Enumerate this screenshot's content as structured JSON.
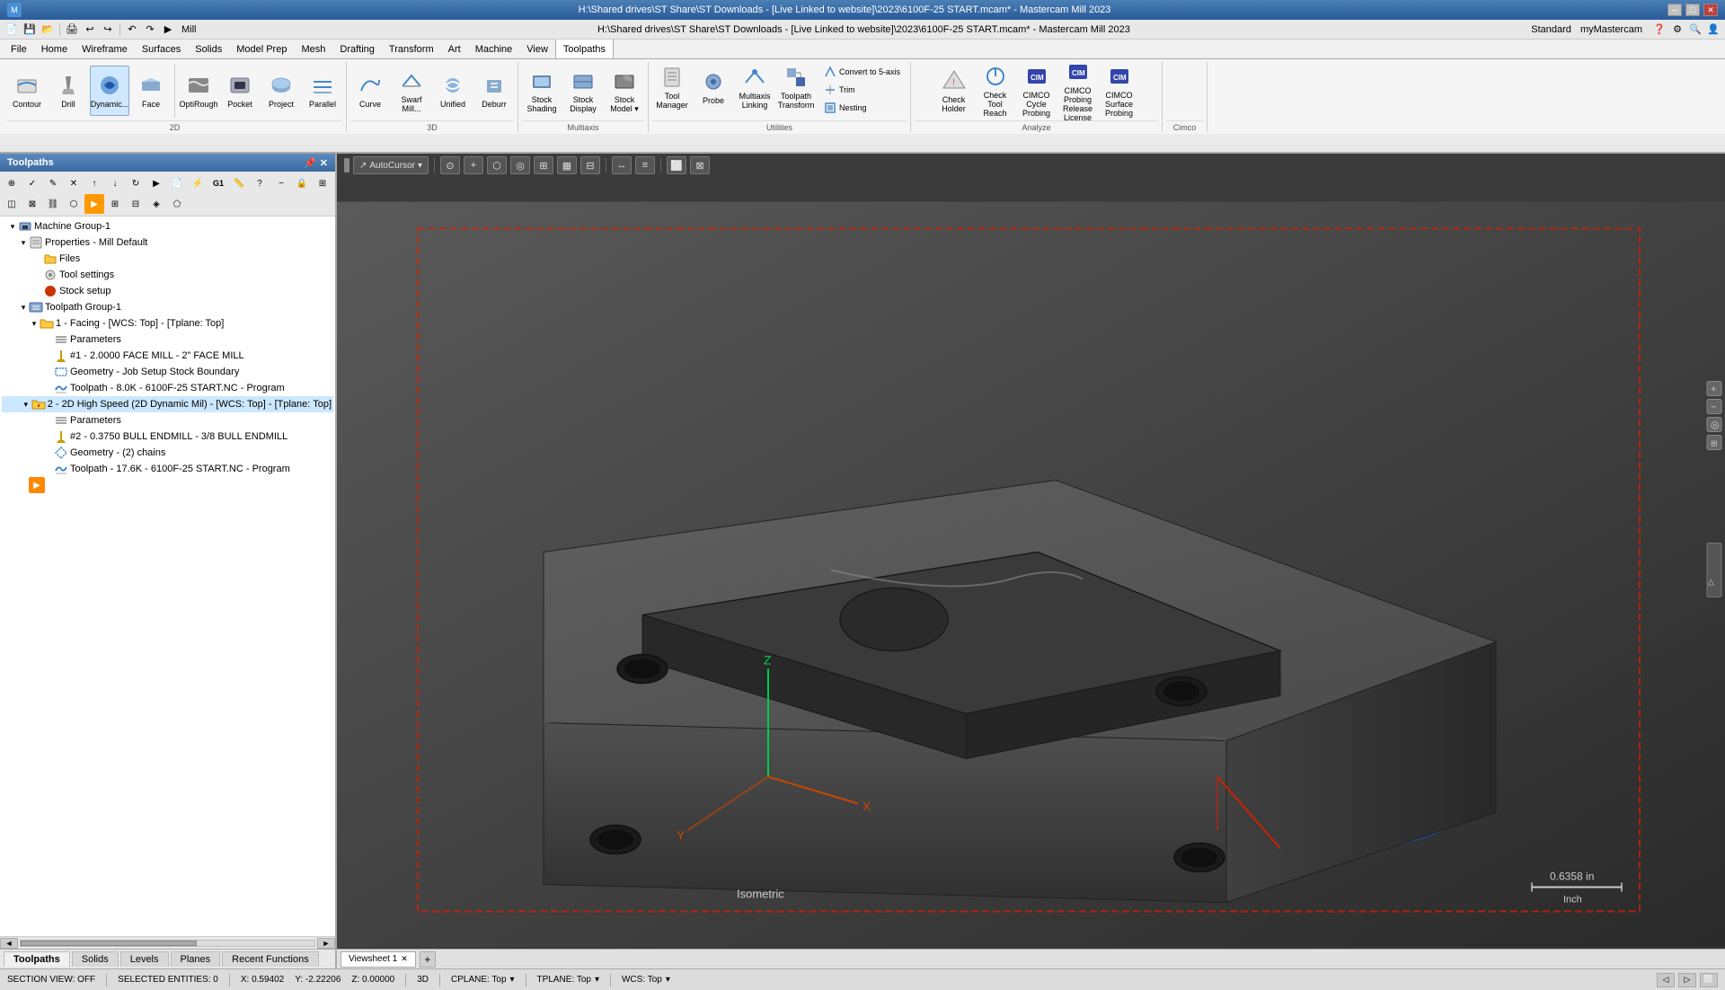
{
  "app": {
    "title": "H:\\Shared drives\\ST Share\\ST Downloads - [Live Linked to website]\\2023\\6100F-25 START.mcam* - Mastercam Mill 2023",
    "window_controls": [
      "minimize",
      "maximize",
      "close"
    ]
  },
  "menubar": {
    "items": [
      "File",
      "Home",
      "Wireframe",
      "Surfaces",
      "Solids",
      "Model Prep",
      "Mesh",
      "Drafting",
      "Transform",
      "Art",
      "Machine",
      "View",
      "Toolpaths"
    ]
  },
  "ribbon": {
    "active_tab": "Toolpaths",
    "tabs": [
      "File",
      "Home",
      "Wireframe",
      "Surfaces",
      "Solids",
      "Model Prep",
      "Mesh",
      "Drafting",
      "Transform",
      "Art",
      "Machine",
      "View",
      "Toolpaths"
    ],
    "groups": {
      "2d": {
        "label": "2D",
        "buttons": [
          "Contour",
          "Drill",
          "Dynamic...",
          "Face",
          "OptiRough",
          "Pocket",
          "Project",
          "Parallel"
        ]
      },
      "3d": {
        "label": "3D",
        "buttons": [
          "Curve",
          "Swarf Mill...",
          "Unified",
          "Deburr"
        ]
      },
      "multiaxis": {
        "label": "Multiaxis",
        "buttons": [
          "Stock Shading",
          "Stock Display",
          "Stock Model"
        ]
      },
      "utilities": {
        "label": "Utilities",
        "buttons": [
          "Tool Manager",
          "Probe",
          "Multiaxis Linking",
          "Toolpath Transform",
          "Convert to 5-axis",
          "Trim",
          "Nesting"
        ]
      },
      "analyze": {
        "label": "Analyze",
        "buttons": [
          "Check Holder",
          "Check Tool Reach",
          "CIMCO Cycle Probing",
          "CIMCO Probing Release License",
          "CIMCO Surface Probing"
        ]
      },
      "cimco": {
        "label": "Cimco"
      }
    }
  },
  "left_panel": {
    "title": "Toolpaths",
    "tree": [
      {
        "id": "machine-group-1",
        "label": "Machine Group-1",
        "level": 0,
        "icon": "machine",
        "expanded": true
      },
      {
        "id": "properties",
        "label": "Properties - Mill Default",
        "level": 1,
        "icon": "properties",
        "expanded": true
      },
      {
        "id": "files",
        "label": "Files",
        "level": 2,
        "icon": "folder"
      },
      {
        "id": "tool-settings",
        "label": "Tool settings",
        "level": 2,
        "icon": "wrench"
      },
      {
        "id": "stock-setup",
        "label": "Stock setup",
        "level": 2,
        "icon": "stock-red"
      },
      {
        "id": "toolpath-group-1",
        "label": "Toolpath Group-1",
        "level": 1,
        "icon": "toolpath-group",
        "expanded": true
      },
      {
        "id": "op1",
        "label": "1 - Facing - [WCS: Top] - [Tplane: Top]",
        "level": 2,
        "icon": "op-folder",
        "expanded": true
      },
      {
        "id": "op1-params",
        "label": "Parameters",
        "level": 3,
        "icon": "params"
      },
      {
        "id": "op1-tool",
        "label": "#1 - 2.0000 FACE MILL - 2\"  FACE MILL",
        "level": 3,
        "icon": "tool-yellow"
      },
      {
        "id": "op1-geo",
        "label": "Geometry - Job Setup Stock Boundary",
        "level": 3,
        "icon": "geometry"
      },
      {
        "id": "op1-toolpath",
        "label": "Toolpath - 8.0K - 6100F-25 START.NC - Program",
        "level": 3,
        "icon": "toolpath-wave"
      },
      {
        "id": "op2",
        "label": "2 - 2D High Speed (2D Dynamic Mil) - [WCS: Top] - [Tplane: Top]",
        "level": 2,
        "icon": "op-folder-active",
        "expanded": true,
        "selected": true
      },
      {
        "id": "op2-params",
        "label": "Parameters",
        "level": 3,
        "icon": "params"
      },
      {
        "id": "op2-tool",
        "label": "#2 - 0.3750 BULL ENDMILL - 3/8 BULL ENDMILL",
        "level": 3,
        "icon": "tool-yellow"
      },
      {
        "id": "op2-geo",
        "label": "Geometry - (2) chains",
        "level": 3,
        "icon": "geometry-chains"
      },
      {
        "id": "op2-toolpath",
        "label": "Toolpath - 17.6K - 6100F-25 START.NC - Program",
        "level": 3,
        "icon": "toolpath-wave"
      }
    ],
    "play_button": "▶",
    "bottom_tabs": [
      "Toolpaths",
      "Solids",
      "Levels",
      "Planes",
      "Recent Functions"
    ]
  },
  "viewport": {
    "toolbar": {
      "autocursor_label": "AutoCursor",
      "buttons": [
        "↗",
        "⊙",
        "+",
        "⬜",
        "◉",
        "⊞",
        "▦",
        "⊟",
        "↔",
        "≡"
      ]
    },
    "isometric_label": "Isometric",
    "scale": {
      "value": "0.6358 in",
      "unit": "Inch"
    },
    "axis": {
      "x": "X",
      "y": "Y",
      "z": "Z"
    }
  },
  "viewsheet": {
    "tabs": [
      {
        "label": "Viewsheet 1",
        "active": true
      }
    ],
    "add_btn": "+"
  },
  "statusbar": {
    "section_view": "SECTION VIEW: OFF",
    "selected": "SELECTED ENTITIES: 0",
    "x": "X: 0.59402",
    "y": "Y: -2.22206",
    "z": "Z: 0.00000",
    "mode": "3D",
    "cplane": "CPLANE: Top",
    "tplane": "TPLANE: Top",
    "wcs": "WCS: Top"
  },
  "quickaccess": {
    "buttons": [
      "💾",
      "📂",
      "↩",
      "↪",
      "▶",
      "⚙",
      "📷",
      "🖨"
    ]
  },
  "colors": {
    "accent_blue": "#4a7fb5",
    "tab_active": "#b8860b",
    "ribbon_bg": "#f5f5f5",
    "viewport_bg": "#3a3a3a",
    "panel_header": "#3a6a9f",
    "tree_selected": "#b8d8f8",
    "red": "#cc2200",
    "blue_outline": "#2266cc"
  }
}
